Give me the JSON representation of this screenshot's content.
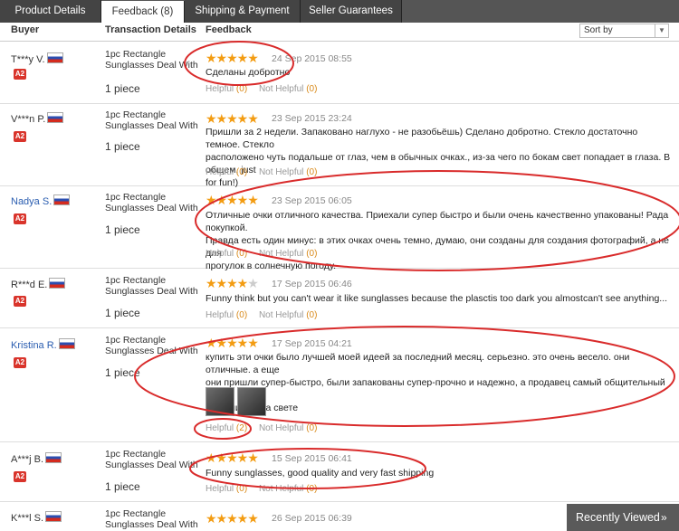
{
  "tabs": [
    {
      "label": "Product Details",
      "active": false
    },
    {
      "label": "Feedback (8)",
      "active": true
    },
    {
      "label": "Shipping & Payment",
      "active": false
    },
    {
      "label": "Seller Guarantees",
      "active": false
    }
  ],
  "table_header": {
    "buyer": "Buyer",
    "transaction": "Transaction Details",
    "feedback": "Feedback"
  },
  "sort": {
    "label": "Sort by"
  },
  "rows": [
    {
      "buyer": "T***y V.",
      "level": "A2",
      "product": [
        "1pc Rectangle",
        "Sunglasses Deal With"
      ],
      "qty": "1 piece",
      "stars": 5,
      "date": "24 Sep 2015 08:55",
      "text": [
        "Сделаны добротно"
      ],
      "helpful_label": "Helpful",
      "helpful_count": "(0)",
      "not_helpful_label": "Not Helpful",
      "not_helpful_count": "(0)"
    },
    {
      "buyer": "V***n P.",
      "level": "A2",
      "product": [
        "1pc Rectangle",
        "Sunglasses Deal With"
      ],
      "qty": "1 piece",
      "stars": 5,
      "date": "23 Sep 2015 23:24",
      "text": [
        "Пришли за 2 недели. Запаковано наглухо - не разобьёшь) Сделано добротно. Стекло достаточно темное. Стекло",
        "расположено чуть подальше от глаз, чем в обычных очках., из-за чего по бокам свет попадает в глаза. В общем, just",
        "for fun!)"
      ],
      "helpful_label": "Helpful",
      "helpful_count": "(0)",
      "not_helpful_label": "Not Helpful",
      "not_helpful_count": "(0)"
    },
    {
      "buyer": "Nadya S.",
      "level": "A2",
      "product": [
        "1pc Rectangle",
        "Sunglasses Deal With"
      ],
      "qty": "1 piece",
      "stars": 5,
      "date": "23 Sep 2015 06:05",
      "text": [
        "Отличные очки отличного качества. Приехали супер быстро и были очень качественно упакованы! Рада покупкой.",
        "Правда есть один минус: в этих очках очень темно, думаю, они созданы для создания фотографий, а не для",
        "прогулок в солнечную погоду."
      ],
      "helpful_label": "Helpful",
      "helpful_count": "(0)",
      "not_helpful_label": "Not Helpful",
      "not_helpful_count": "(0)"
    },
    {
      "buyer": "R***d E.",
      "level": "A2",
      "product": [
        "1pc Rectangle",
        "Sunglasses Deal With"
      ],
      "qty": "1 piece",
      "stars": 4,
      "date": "17 Sep 2015 06:46",
      "text": [
        "Funny think but you can't wear it like sunglasses because the plasctis too dark you almostcan't see anything..."
      ],
      "helpful_label": "Helpful",
      "helpful_count": "(0)",
      "not_helpful_label": "Not Helpful",
      "not_helpful_count": "(0)"
    },
    {
      "buyer": "Kristina R.",
      "level": "A2",
      "product": [
        "1pc Rectangle",
        "Sunglasses Deal With"
      ],
      "qty": "1 piece",
      "stars": 5,
      "date": "17 Sep 2015 04:21",
      "text": [
        "купить эти очки было лучшей моей идеей за последний месяц. серьезно. это очень весело. они отличные. а еще",
        "они пришли супер-быстро, были запакованы супер-прочно и надежно, а продавец самый общительный и",
        "заботливый на свете"
      ],
      "helpful_label": "Helpful",
      "helpful_count": "(2)",
      "not_helpful_label": "Not Helpful",
      "not_helpful_count": "(0)"
    },
    {
      "buyer": "A***j B.",
      "level": "A2",
      "product": [
        "1pc Rectangle",
        "Sunglasses Deal With"
      ],
      "qty": "1 piece",
      "stars": 5,
      "date": "15 Sep 2015 06:41",
      "text": [
        "Funny sunglasses, good quality and very fast shipping"
      ],
      "helpful_label": "Helpful",
      "helpful_count": "(0)",
      "not_helpful_label": "Not Helpful",
      "not_helpful_count": "(0)"
    },
    {
      "buyer": "K***l S.",
      "level": "",
      "product": [
        "1pc Rectangle",
        "Sunglasses Deal With"
      ],
      "qty": "",
      "stars": 5,
      "date": "26 Sep 2015 06:39",
      "text": [],
      "helpful_label": "",
      "helpful_count": "",
      "not_helpful_label": "",
      "not_helpful_count": ""
    }
  ],
  "recently_viewed": {
    "label": "Recently Viewed",
    "chevron": "»"
  },
  "colors": {
    "star": "#f39c12",
    "highlight": "#d92b2b",
    "link": "#2a5db0",
    "tab_bar": "#555555",
    "level_badge": "#d9342b"
  }
}
